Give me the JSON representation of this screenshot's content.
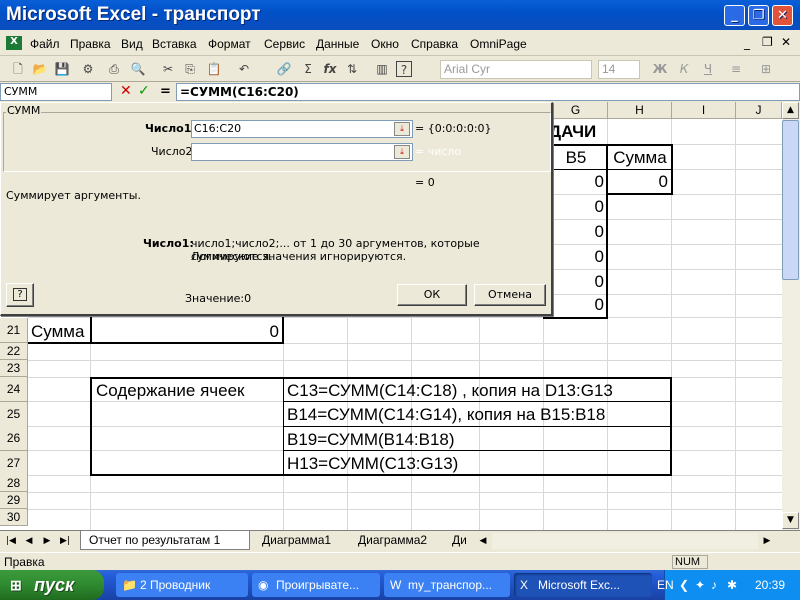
{
  "window": {
    "title": "Microsoft Excel - транспорт"
  },
  "menu": [
    "Файл",
    "Правка",
    "Вид",
    "Вставка",
    "Формат",
    "Сервис",
    "Данные",
    "Окно",
    "Справка",
    "OmniPage"
  ],
  "toolbar": {
    "font_name": "Arial Cyr",
    "font_size": "14",
    "bold": "Ж",
    "italic": "К",
    "underline": "Ч"
  },
  "formula_bar": {
    "name_box": "СУММ",
    "formula": "=СУММ(C16:C20)"
  },
  "dialog": {
    "title": "СУММ",
    "arg1_label": "Число1",
    "arg1_value": "C16:C20",
    "arg1_result": "= {0:0:0:0:0}",
    "arg2_label": "Число2",
    "arg2_result": "= число",
    "total": "= 0",
    "description": "Суммирует аргументы.",
    "help_label": "Число1:",
    "help_text_1": "число1;число2;... от 1 до 30 аргументов, которые суммируются.",
    "help_text_2": "Логические значения игнорируются.",
    "value_text": "Значение:0",
    "ok": "ОК",
    "cancel": "Отмена"
  },
  "columns": [
    "G",
    "H",
    "I",
    "J"
  ],
  "cells": {
    "header_partial": "ДАЧИ",
    "g12": "В5",
    "h12": "Сумма",
    "g13": "0",
    "h13": "0",
    "g14": "0",
    "g15": "0",
    "g16": "0",
    "g17": "0",
    "g18": "0",
    "a21": "Сумма",
    "b21": "0",
    "b24": "Содержание ячеек",
    "c24": "C13=СУММ(C14:C18) , копия на D13:G13",
    "c25": "B14=СУММ(C14:G14), копия на B15:B18",
    "c26": "B19=СУММ(B14:B18)",
    "c27": "H13=СУММ(C13:G13)"
  },
  "rows": [
    "21",
    "22",
    "23",
    "24",
    "25",
    "26",
    "27",
    "28",
    "29",
    "30"
  ],
  "sheet_tabs": [
    "Отчет по результатам 1",
    "Диаграмма1",
    "Диаграмма2",
    "Ди"
  ],
  "status": {
    "text": "Правка",
    "num": "NUM"
  },
  "taskbar": {
    "start": "пуск",
    "tasks": [
      "2 Проводник",
      "Проигрывате...",
      "my_транспор...",
      "Microsoft Exc..."
    ],
    "lang": "EN",
    "clock": "20:39"
  }
}
